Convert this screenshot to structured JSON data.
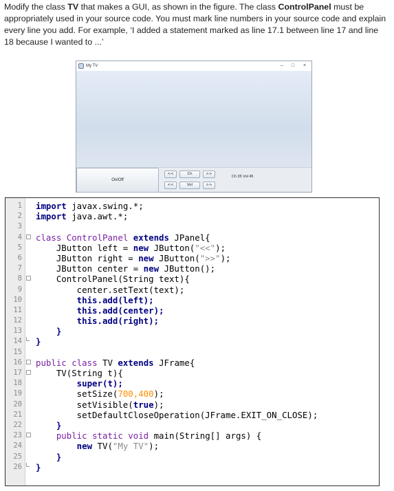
{
  "instructions": {
    "part1": "Modify the class ",
    "tv": "TV",
    "part2": " that makes a GUI, as shown in the figure. The class ",
    "control_panel": "ControlPanel",
    "part3": " must be appropriately used in your source code. You must mark line numbers in your source code and explain every line you add. For example, ‘I added a statement marked as line 17.1 between line 17 and line 18 because I wanted to ...’"
  },
  "window": {
    "title": "My TV",
    "minimize": "–",
    "maximize": "□",
    "close": "×",
    "on_off": "On/Off",
    "ch_left": "<<",
    "ch_center": "Ch",
    "ch_right": ">>",
    "vol_left": "<<",
    "vol_center": "Vol",
    "vol_right": ">>",
    "status": "Ch 35 Vol 45"
  },
  "code": {
    "line_numbers": [
      "1",
      "2",
      "3",
      "4",
      "5",
      "6",
      "7",
      "8",
      "9",
      "10",
      "11",
      "12",
      "13",
      "14",
      "15",
      "16",
      "17",
      "18",
      "19",
      "20",
      "21",
      "22",
      "23",
      "24",
      "25",
      "26"
    ],
    "l1_kw": "import",
    "l1_rest": " javax.swing.*;",
    "l2_kw": "import",
    "l2_rest": " java.awt.*;",
    "l4_a": "class ControlPanel ",
    "l4_kw": "extends",
    "l4_b": " JPanel{",
    "l5_a": "JButton left = ",
    "l5_kw": "new",
    "l5_b": " JButton(",
    "l5_str": "\"<<\"",
    "l5_c": ");",
    "l6_a": "JButton right = ",
    "l6_kw": "new",
    "l6_b": " JButton(",
    "l6_str": "\">>\"",
    "l6_c": ");",
    "l7_a": "JButton center = ",
    "l7_kw": "new",
    "l7_b": " JButton();",
    "l8": "ControlPanel(String text){",
    "l9": "center.setText(text);",
    "l10_kw": "this",
    "l10_b": ".add(left);",
    "l11_kw": "this",
    "l11_b": ".add(center);",
    "l12_kw": "this",
    "l12_b": ".add(right);",
    "l13": "}",
    "l14": "}",
    "l16_kw1": "public",
    "l16_a": " ",
    "l16_kw2": "class",
    "l16_b": " TV ",
    "l16_kw3": "extends",
    "l16_c": " JFrame{",
    "l17": "TV(String t){",
    "l18_kw": "super",
    "l18_b": "(t);",
    "l19_a": "setSize(",
    "l19_n1": "700",
    "l19_comma": ",",
    "l19_n2": "400",
    "l19_b": ");",
    "l20_a": "setVisible(",
    "l20_kw": "true",
    "l20_b": ");",
    "l21": "setDefaultCloseOperation(JFrame.EXIT_ON_CLOSE);",
    "l22": "}",
    "l23_kw1": "public",
    "l23_a": " ",
    "l23_kw2": "static",
    "l23_b": " ",
    "l23_kw3": "void",
    "l23_c": " main(String[] args) {",
    "l24_kw": "new",
    "l24_b": " TV(",
    "l24_str": "\"My TV\"",
    "l24_c": ");",
    "l25": "}",
    "l26": "}"
  }
}
